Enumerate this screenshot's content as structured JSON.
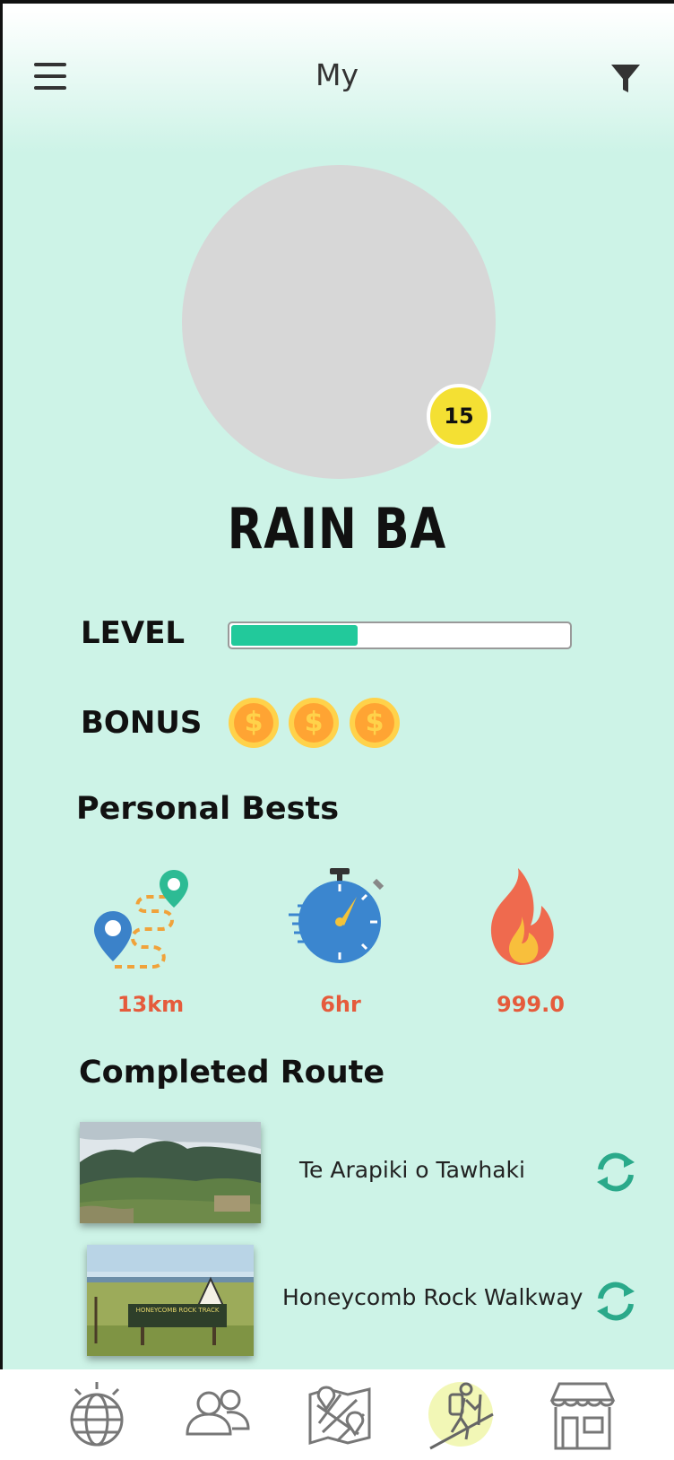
{
  "header": {
    "title": "My",
    "menu_icon": "hamburger-menu-icon",
    "filter_icon": "filter-funnel-icon"
  },
  "profile": {
    "level_number": "15",
    "name": "RAIN BA",
    "level_progress_fraction": 0.37
  },
  "level": {
    "label": "LEVEL"
  },
  "bonus": {
    "label": "BONUS",
    "coins": [
      "$",
      "$",
      "$"
    ],
    "coin_icon": "dollar-coin-icon"
  },
  "personal_bests": {
    "title": "Personal Bests",
    "items": [
      {
        "icon": "route-distance-icon",
        "value": "13km"
      },
      {
        "icon": "stopwatch-icon",
        "value": "6hr"
      },
      {
        "icon": "fire-icon",
        "value": "999.0"
      }
    ]
  },
  "completed_route": {
    "title": "Completed Route",
    "routes": [
      {
        "name": "Te Arapiki o Tawhaki"
      },
      {
        "name": "Honeycomb Rock Walkway",
        "sign_text": "HONEYCOMB ROCK TRACK"
      }
    ]
  },
  "bottom_nav": {
    "items": [
      {
        "icon": "globe-icon"
      },
      {
        "icon": "friends-icon"
      },
      {
        "icon": "map-icon"
      },
      {
        "icon": "hiker-icon",
        "active": true
      },
      {
        "icon": "store-icon"
      }
    ]
  },
  "colors": {
    "background": "#cdf3e7",
    "accent": "#22c99b",
    "badge": "#f4e033",
    "value_text": "#e55b3c",
    "active_nav": "#f2f7b6"
  }
}
